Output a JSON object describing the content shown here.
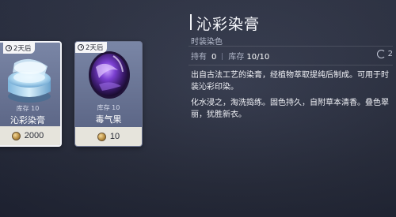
{
  "items": [
    {
      "timer": "2天后",
      "stock": "库存 10",
      "name": "沁彩染膏",
      "price": "2000",
      "icon": "dye-jar-icon"
    },
    {
      "timer": "2天后",
      "stock": "库存 10",
      "name": "毒气果",
      "price": "10",
      "icon": "poison-fruit-icon"
    }
  ],
  "detail": {
    "title": "沁彩染膏",
    "subtitle": "时装染色",
    "owned_label": "持有",
    "owned_value": "0",
    "stock_label": "库存",
    "stock_value": "10/10",
    "refresh_value": "2",
    "desc1": "出自古法工艺的染膏，经植物萃取提纯后制成。可用于时装沁彩印染。",
    "desc2": "化水浸之，淘洗捣练。固色持久，自附草本清香。叠色翠丽，犹胜新衣。"
  },
  "colors": {
    "selected_border": "#f3f4f8",
    "price_bar": "#e6e4dc",
    "card_bg": "#6c7798"
  }
}
